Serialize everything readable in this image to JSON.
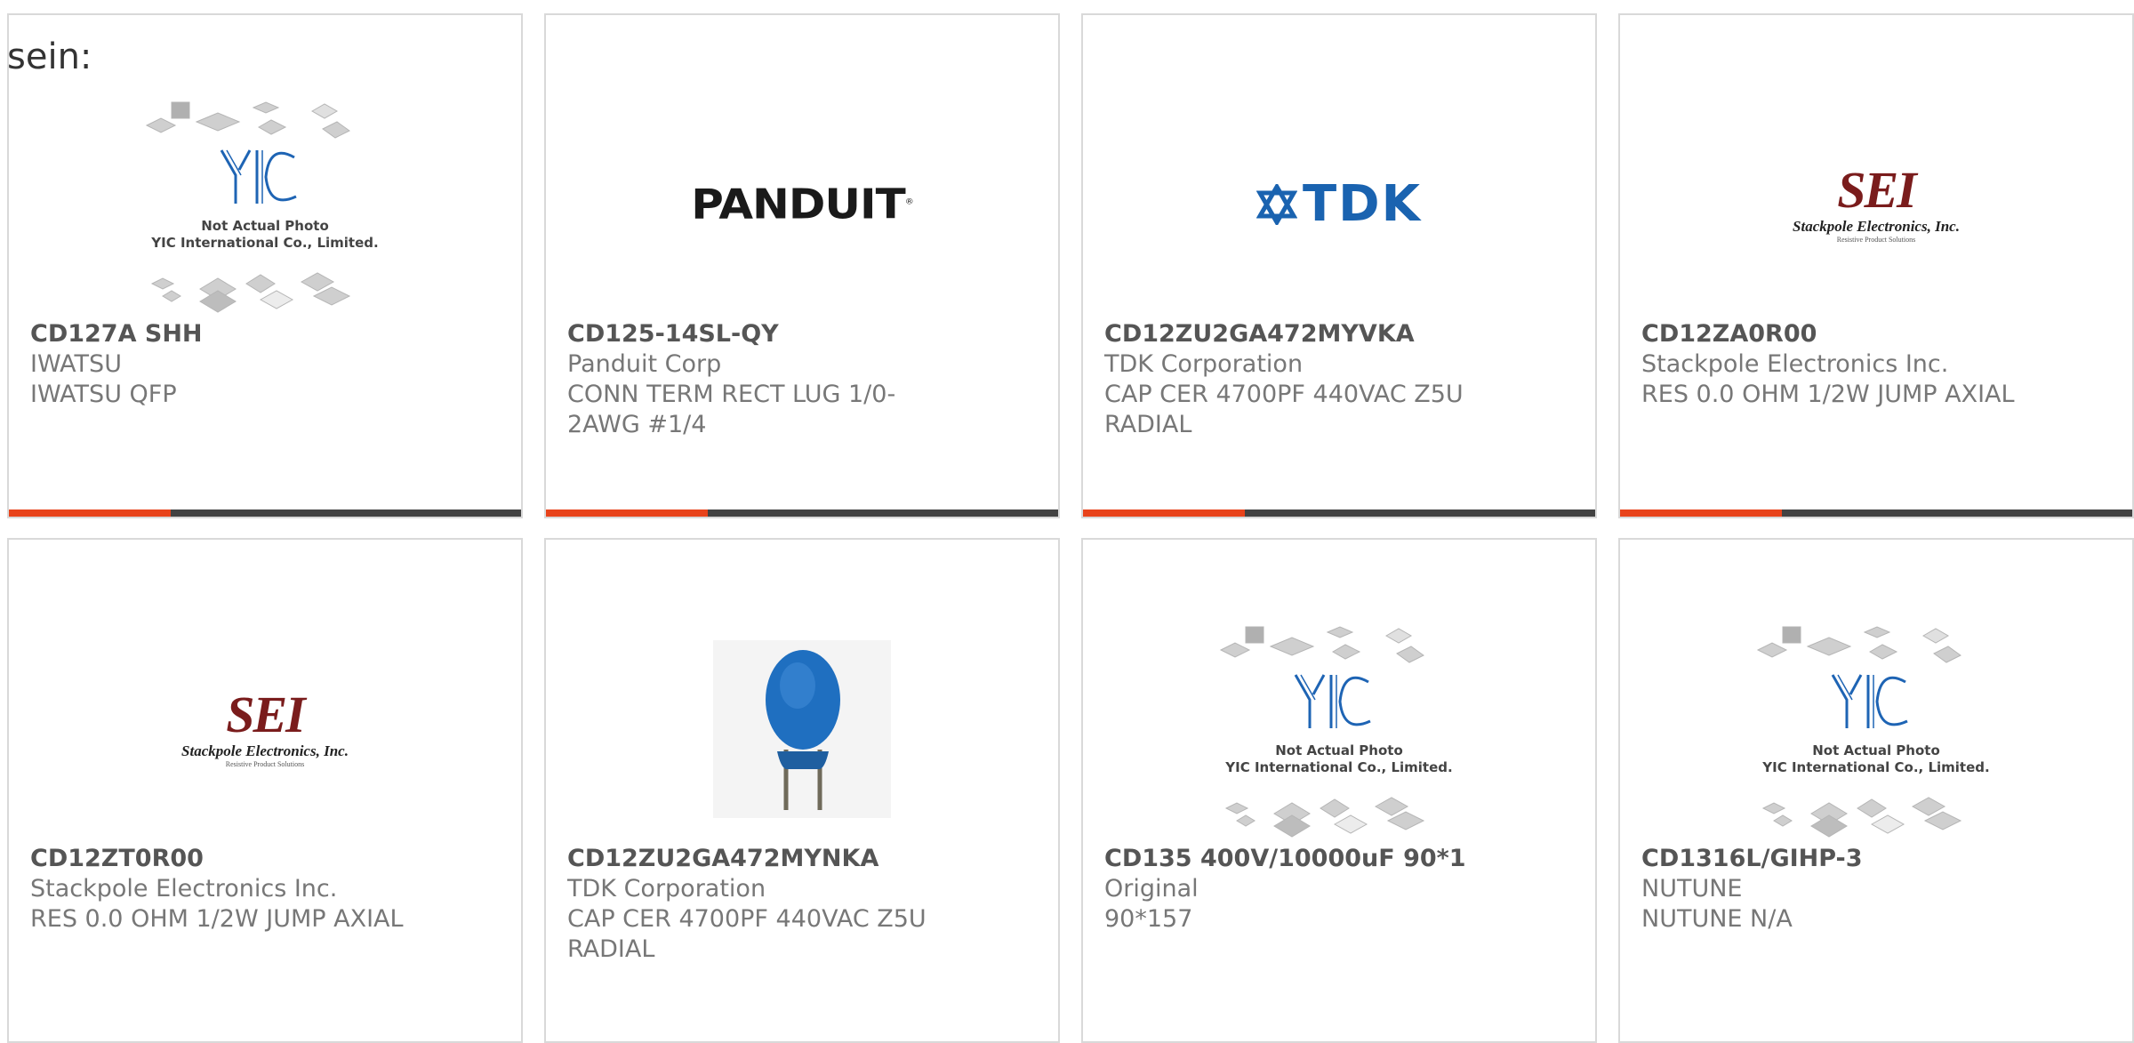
{
  "intro_text": "sein:",
  "placeholder_caption_line1": "Not Actual Photo",
  "placeholder_caption_line2": "YIC International Co., Limited.",
  "placeholder_logo": "YIC",
  "colors": {
    "accent": "#e8431b",
    "bar": "#424242",
    "border": "#d9d9d9"
  },
  "products": [
    {
      "part": "CD127A SHH",
      "manufacturer": "IWATSU",
      "description": "IWATSU QFP",
      "image": "yic-placeholder"
    },
    {
      "part": "CD125-14SL-QY",
      "manufacturer": "Panduit Corp",
      "description": "CONN TERM RECT LUG 1/0-2AWG #1/4",
      "image": "panduit-logo",
      "logo_text": "PANDUIT",
      "logo_mark": "®"
    },
    {
      "part": "CD12ZU2GA472MYVKA",
      "manufacturer": "TDK Corporation",
      "description": "CAP CER 4700PF 440VAC Z5U RADIAL",
      "image": "tdk-logo",
      "logo_text": "TDK"
    },
    {
      "part": "CD12ZA0R00",
      "manufacturer": "Stackpole Electronics Inc.",
      "description": "RES 0.0 OHM 1/2W JUMP AXIAL",
      "image": "sei-logo",
      "logo_main": "SEI",
      "logo_sub": "Stackpole Electronics, Inc.",
      "logo_tag": "Resistive Product Solutions"
    },
    {
      "part": "CD12ZT0R00",
      "manufacturer": "Stackpole Electronics Inc.",
      "description": "RES 0.0 OHM 1/2W JUMP AXIAL",
      "image": "sei-logo",
      "logo_main": "SEI",
      "logo_sub": "Stackpole Electronics, Inc.",
      "logo_tag": "Resistive Product Solutions"
    },
    {
      "part": "CD12ZU2GA472MYNKA",
      "manufacturer": "TDK Corporation",
      "description": "CAP CER 4700PF 440VAC Z5U RADIAL",
      "image": "capacitor-photo"
    },
    {
      "part": "CD135 400V/10000uF 90*1",
      "manufacturer": "Original",
      "description": "90*157",
      "image": "yic-placeholder"
    },
    {
      "part": "CD1316L/GIHP-3",
      "manufacturer": "NUTUNE",
      "description": "NUTUNE N/A",
      "image": "yic-placeholder"
    }
  ]
}
